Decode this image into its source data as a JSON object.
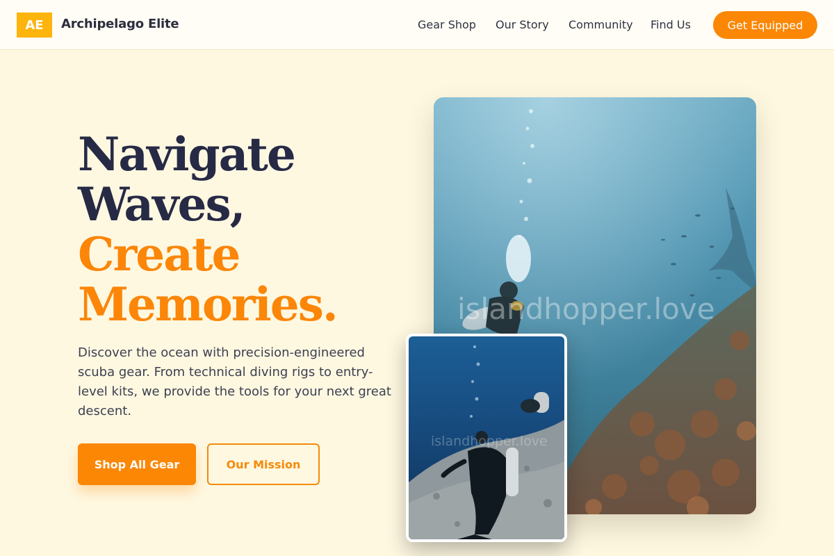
{
  "header": {
    "logo_text": "AE",
    "brand_name": "Archipelago Elite",
    "nav": [
      {
        "label": "Gear Shop"
      },
      {
        "label": "Our Story"
      },
      {
        "label": "Community"
      },
      {
        "label": "Find Us"
      }
    ],
    "cta_label": "Get Equipped"
  },
  "hero": {
    "headline": {
      "line1": "Navigate",
      "line2": "Waves,",
      "line3": "Create",
      "line4": "Memories."
    },
    "description": "Discover the ocean with precision-engineered scuba gear. From technical diving rigs to entry-level kits, we provide the tools for your next great descent.",
    "primary_button": "Shop All Gear",
    "secondary_button": "Our Mission"
  },
  "images": {
    "main_watermark": "islandhopper.love",
    "inset_watermark": "islandhopper.love"
  },
  "colors": {
    "background": "#fef8e1",
    "accent_orange": "#fb8705",
    "logo_yellow": "#fdb40d",
    "headline_dark": "#272a45"
  }
}
